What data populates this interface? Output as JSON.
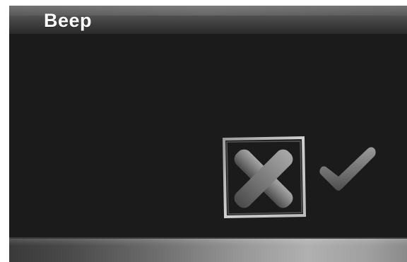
{
  "header": {
    "title": "Beep"
  },
  "dialog": {
    "options": [
      {
        "icon": "cross-icon",
        "selected": true
      },
      {
        "icon": "checkmark-icon",
        "selected": false
      }
    ]
  },
  "colors": {
    "background": "#1c1c1c",
    "title_text": "#ffffff",
    "icon_gray": "#8a8a8a",
    "selection_frame": "#bdbdbd"
  }
}
